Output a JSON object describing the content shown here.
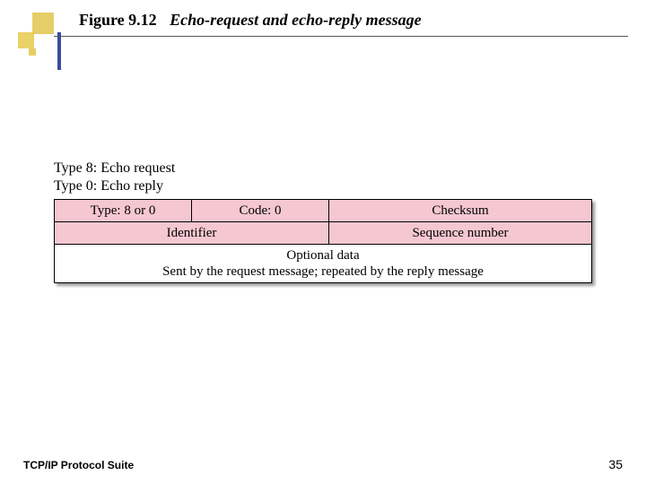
{
  "title": {
    "fignum": "Figure 9.12",
    "desc": "Echo-request and echo-reply message"
  },
  "type_labels": {
    "line1": "Type 8: Echo request",
    "line2": "Type 0: Echo reply"
  },
  "packet": {
    "row1": {
      "type": "Type: 8 or 0",
      "code": "Code: 0",
      "checksum": "Checksum"
    },
    "row2": {
      "identifier": "Identifier",
      "seqnum": "Sequence number"
    },
    "row3": {
      "line1": "Optional data",
      "line2": "Sent by the request message; repeated by the reply message"
    }
  },
  "footer": {
    "left": "TCP/IP Protocol Suite",
    "pagenum": "35"
  }
}
